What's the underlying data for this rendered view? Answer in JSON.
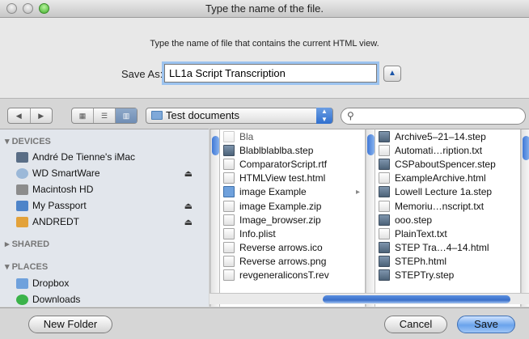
{
  "window": {
    "title": "Type the name of the file."
  },
  "dialog": {
    "prompt": "Type the name of file that contains the current HTML view.",
    "save_as_label": "Save As:",
    "save_as_value": "LL1a Script Transcription"
  },
  "toolbar": {
    "back_icon": "back-arrow-icon",
    "forward_icon": "forward-arrow-icon",
    "view_modes": [
      "icon-view",
      "list-view",
      "column-view"
    ],
    "active_view": "column-view",
    "location": "Test documents",
    "search_placeholder": ""
  },
  "sidebar": {
    "devices_header": "DEVICES",
    "devices": [
      {
        "label": "André De Tienne's iMac",
        "icon": "imac-icon",
        "eject": false,
        "color": "#5a6e86"
      },
      {
        "label": "WD SmartWare",
        "icon": "cd-icon",
        "eject": true,
        "color": "#9bb8d8"
      },
      {
        "label": "Macintosh HD",
        "icon": "hard-drive-icon",
        "eject": false,
        "color": "#8c8c8c"
      },
      {
        "label": "My Passport",
        "icon": "external-drive-icon",
        "eject": true,
        "color": "#4e84c9"
      },
      {
        "label": "ANDREDT",
        "icon": "usb-drive-icon",
        "eject": true,
        "color": "#e3a23a"
      }
    ],
    "shared_header": "SHARED",
    "places_header": "PLACES",
    "places": [
      {
        "label": "Dropbox",
        "icon": "dropbox-folder-icon",
        "color": "#6fa1dc"
      },
      {
        "label": "Downloads",
        "icon": "downloads-icon",
        "color": "#3bb34a"
      }
    ]
  },
  "column1": {
    "files": [
      {
        "name": "Bla",
        "kind": "doc",
        "dim": true
      },
      {
        "name": "Blablblablba.step",
        "kind": "step",
        "dim": false
      },
      {
        "name": "ComparatorScript.rtf",
        "kind": "doc",
        "dim": false
      },
      {
        "name": "HTMLView test.html",
        "kind": "doc",
        "dim": false
      },
      {
        "name": "image Example",
        "kind": "folder",
        "dim": false
      },
      {
        "name": "image Example.zip",
        "kind": "doc",
        "dim": false
      },
      {
        "name": "Image_browser.zip",
        "kind": "doc",
        "dim": false
      },
      {
        "name": "Info.plist",
        "kind": "doc",
        "dim": false
      },
      {
        "name": "Reverse arrows.ico",
        "kind": "doc",
        "dim": false
      },
      {
        "name": "Reverse arrows.png",
        "kind": "doc",
        "dim": false
      },
      {
        "name": "revgeneraliconsT.rev",
        "kind": "doc",
        "dim": false
      }
    ]
  },
  "column2": {
    "files": [
      {
        "name": "Archive5–21–14.step",
        "kind": "step"
      },
      {
        "name": "Automati…ription.txt",
        "kind": "doc"
      },
      {
        "name": "CSPaboutSpencer.step",
        "kind": "step"
      },
      {
        "name": "ExampleArchive.html",
        "kind": "doc"
      },
      {
        "name": "Lowell Lecture 1a.step",
        "kind": "step"
      },
      {
        "name": "Memoriu…nscript.txt",
        "kind": "doc"
      },
      {
        "name": "ooo.step",
        "kind": "step"
      },
      {
        "name": "PlainText.txt",
        "kind": "doc"
      },
      {
        "name": "STEP Tra…4–14.html",
        "kind": "step"
      },
      {
        "name": "STEPh.html",
        "kind": "step"
      },
      {
        "name": "STEPTry.step",
        "kind": "step"
      }
    ]
  },
  "footer": {
    "new_folder": "New Folder",
    "cancel": "Cancel",
    "save": "Save"
  }
}
